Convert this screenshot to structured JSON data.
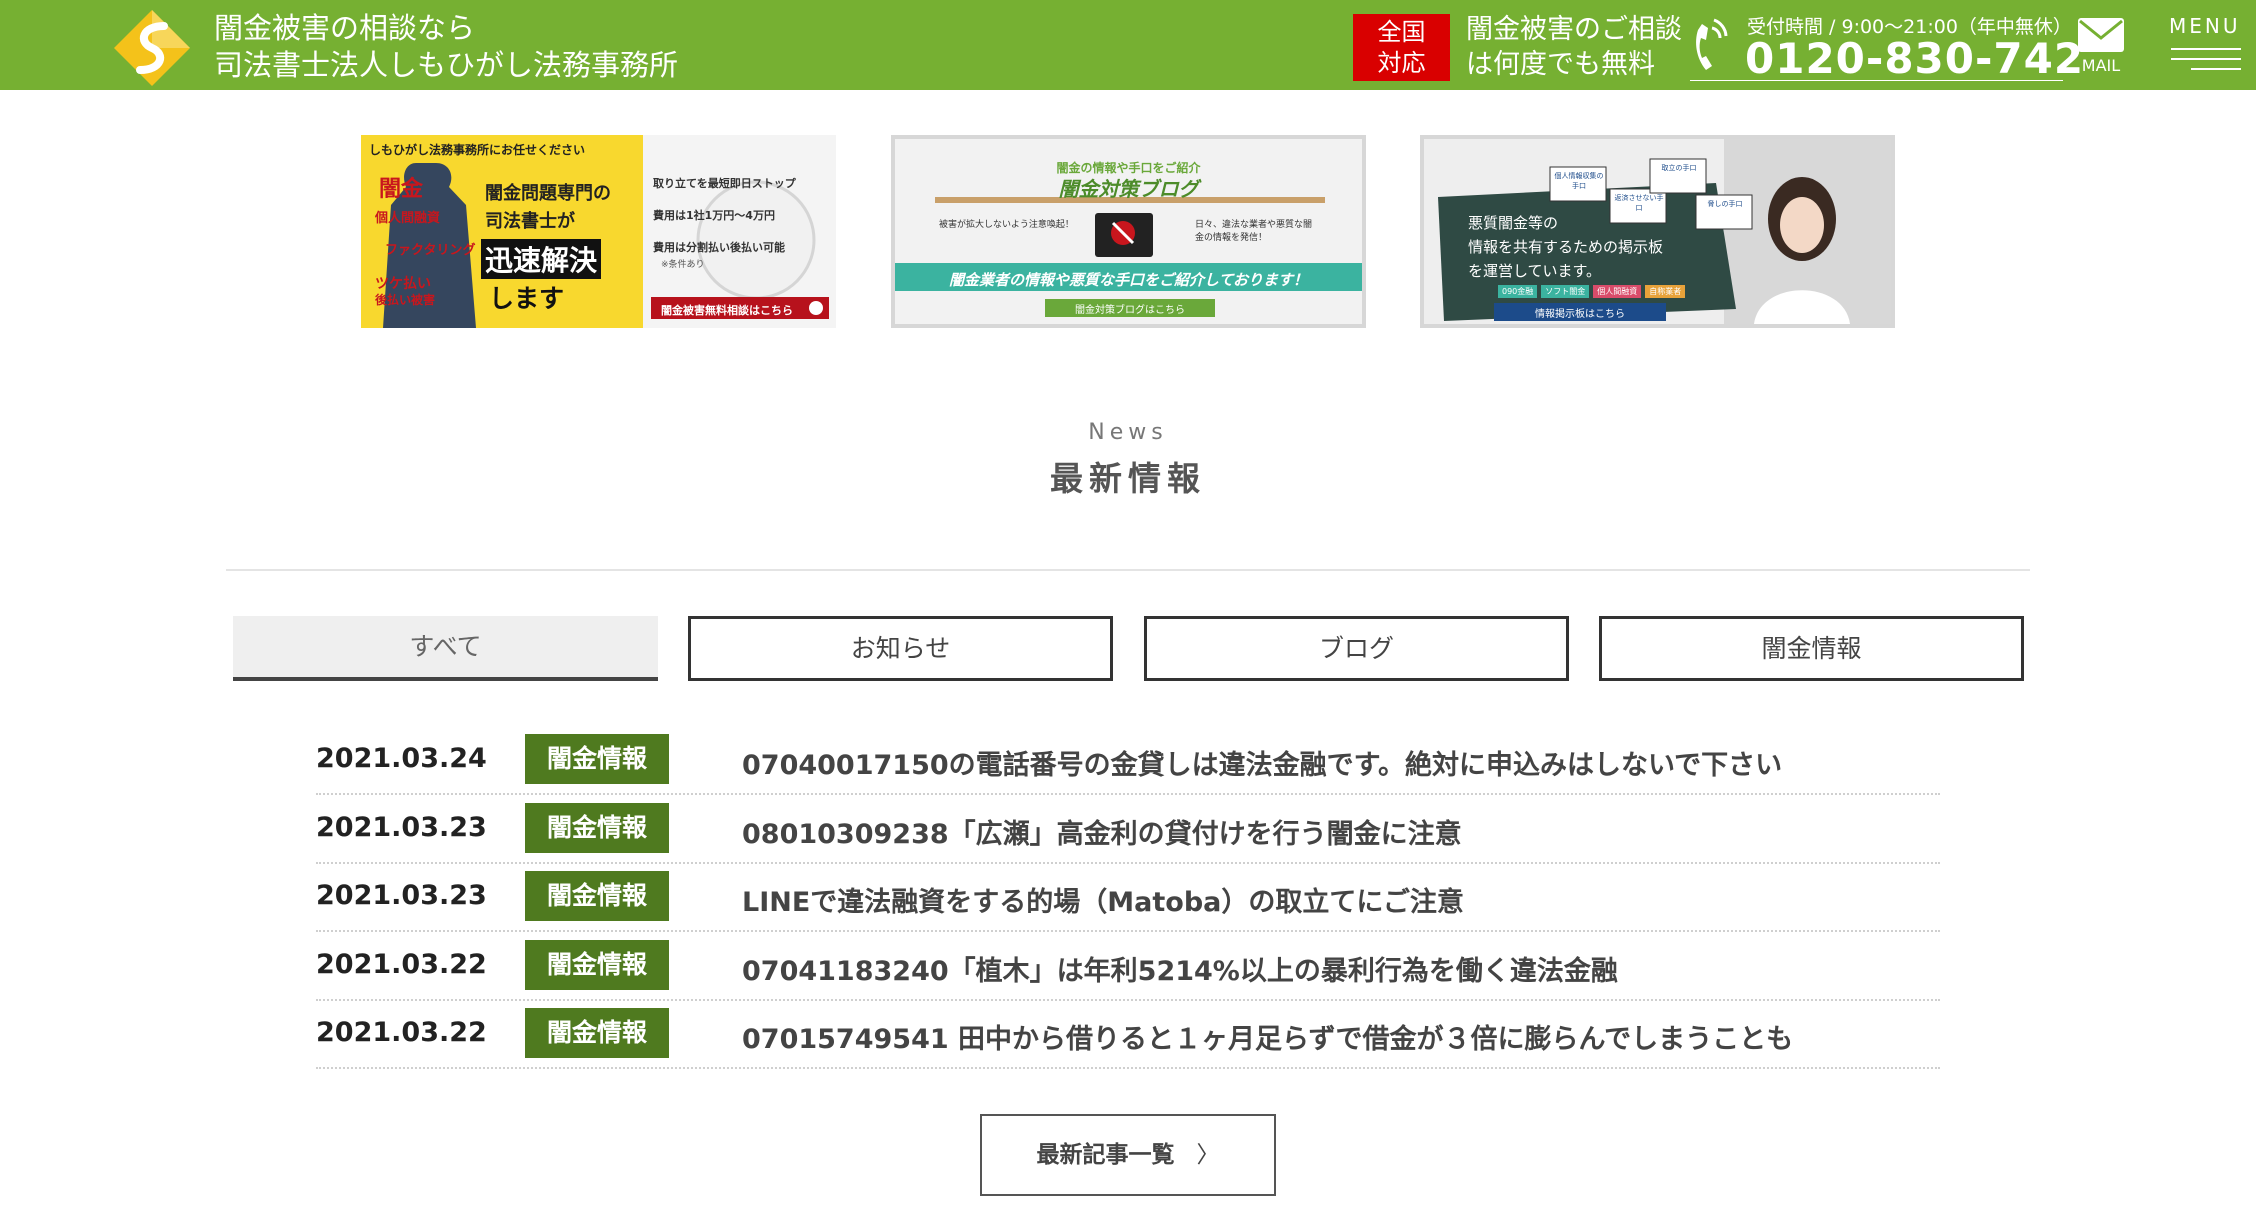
{
  "header": {
    "brand_line1": "闇金被害の相談なら",
    "brand_line2": "司法書士法人しもひがし法務事務所",
    "badge_line1": "全国",
    "badge_line2": "対応",
    "free_line1": "闇金被害のご相談",
    "free_line2": "は何度でも無料",
    "hours": "受付時間 / 9:00～21:00（年中無休）",
    "tel": "0120-830-742",
    "mail_label": "MAIL",
    "menu_label": "MENU",
    "accent": "#76b032",
    "badge_color": "#d90000"
  },
  "banners": {
    "b1": {
      "top": "しもひがし法務事務所にお任せください",
      "left_words": [
        "闇金",
        "個人間融資",
        "ファクタリング",
        "ツケ払い",
        "後払い被害"
      ],
      "mid1": "闇金問題専門の",
      "mid2": "司法書士が",
      "mid3": "迅速解決",
      "mid4": "します",
      "r1": "取り立てを最短即日ストップ",
      "r2": "費用は1社1万円～4万円",
      "r3": "費用は分割払い後払い可能",
      "r3b": "※条件あり",
      "cta": "闇金被害無料相談はこちら"
    },
    "b2": {
      "sub": "闇金の情報や手口をご紹介",
      "title": "闇金対策ブログ",
      "note1": "被害が拡大しないよう注意喚起！",
      "note2": "日々、違法な業者や悪質な闇金の情報を発信！",
      "stripe": "闇金業者の情報や悪質な手口をご紹介しております！",
      "cta": "闇金対策ブログはこちら"
    },
    "b3": {
      "line1": "悪質闇金等の",
      "line2": "情報を共有するための掲示板",
      "line3": "を運営しています。",
      "tags": [
        "090金融",
        "ソフト闇金",
        "個人間融資",
        "自称業者"
      ],
      "cta": "情報掲示板はこちら",
      "cards": [
        "個人情報収集の手口",
        "返済させない手口",
        "取立の手口",
        "脅しの手口"
      ]
    }
  },
  "news": {
    "en": "News",
    "ja": "最新情報",
    "tabs": [
      "すべて",
      "お知らせ",
      "ブログ",
      "闇金情報"
    ],
    "items": [
      {
        "date": "2021.03.24",
        "cat": "闇金情報",
        "title": "07040017150の電話番号の金貸しは違法金融です。絶対に申込みはしないで下さい"
      },
      {
        "date": "2021.03.23",
        "cat": "闇金情報",
        "title": "08010309238「広瀬」高金利の貸付けを行う闇金に注意"
      },
      {
        "date": "2021.03.23",
        "cat": "闇金情報",
        "title": "LINEで違法融資をする的場（Matoba）の取立てにご注意"
      },
      {
        "date": "2021.03.22",
        "cat": "闇金情報",
        "title": "07041183240「植木」は年利5214%以上の暴利行為を働く違法金融"
      },
      {
        "date": "2021.03.22",
        "cat": "闇金情報",
        "title": "07015749541 田中から借りると１ヶ月足らずで借金が３倍に膨らんでしまうことも"
      }
    ],
    "more": "最新記事一覧"
  }
}
